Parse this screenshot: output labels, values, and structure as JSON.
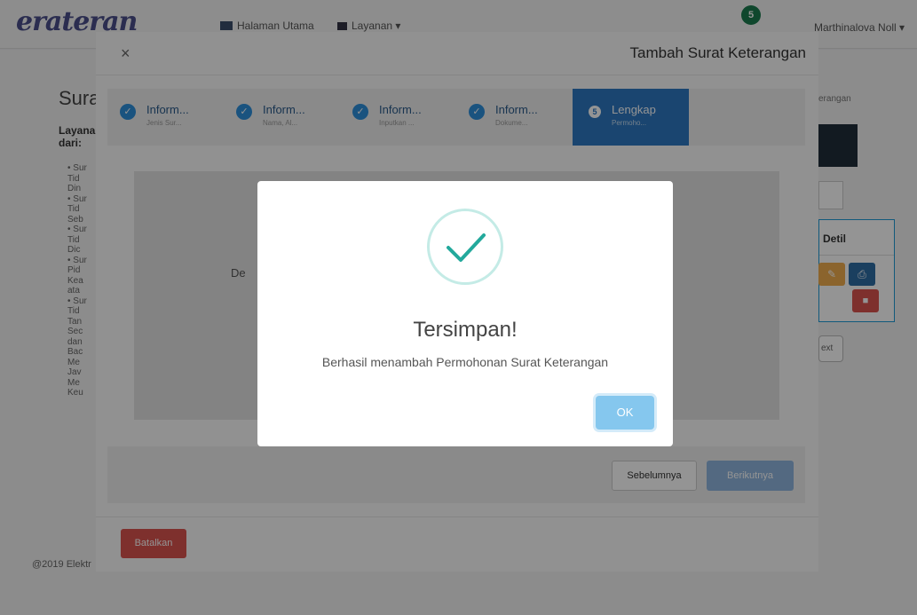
{
  "nav": {
    "brand": "erateran",
    "home": "Halaman Utama",
    "services": "Layanan ▾",
    "notif_count": "5",
    "user": "Marthinalova Noll ▾"
  },
  "background": {
    "title": "Sura",
    "subtitle": "Layanan dari:",
    "list_lines": [
      "• Sur",
      "Tid",
      "Din",
      "• Sur",
      "Tid",
      "Seb",
      "• Sur",
      "Tid",
      "Dic",
      "• Sur",
      "Pid",
      "Kea",
      "ata",
      "• Sur",
      "Tid",
      "Tan",
      "Sec",
      "dan",
      "Bac",
      "Me",
      "Jav",
      "Me",
      "Keu"
    ],
    "crumb": "erangan",
    "table_header": "Detil",
    "next_label": "ext",
    "footer": "@2019 Elektr"
  },
  "modal": {
    "title": "Tambah Surat Keterangan",
    "close": "×",
    "steps": [
      {
        "label": "Inform...",
        "sub": "Jenis Sur...",
        "marker": "✓"
      },
      {
        "label": "Inform...",
        "sub": "Nama, Al...",
        "marker": "✓"
      },
      {
        "label": "Inform...",
        "sub": "Inputkan ...",
        "marker": "✓"
      },
      {
        "label": "Inform...",
        "sub": "Dokume...",
        "marker": "✓"
      },
      {
        "label": "Lengkap",
        "sub": "Permoho...",
        "marker": "5"
      }
    ],
    "content_peek": "De",
    "prev": "Sebelumnya",
    "next": "Berikutnya",
    "cancel": "Batalkan"
  },
  "alert": {
    "title": "Tersimpan!",
    "message": "Berhasil menambah Permohonan Surat Keterangan",
    "ok": "OK",
    "colors": {
      "check": "#23a99c",
      "ok_button": "#85c7ee"
    }
  }
}
